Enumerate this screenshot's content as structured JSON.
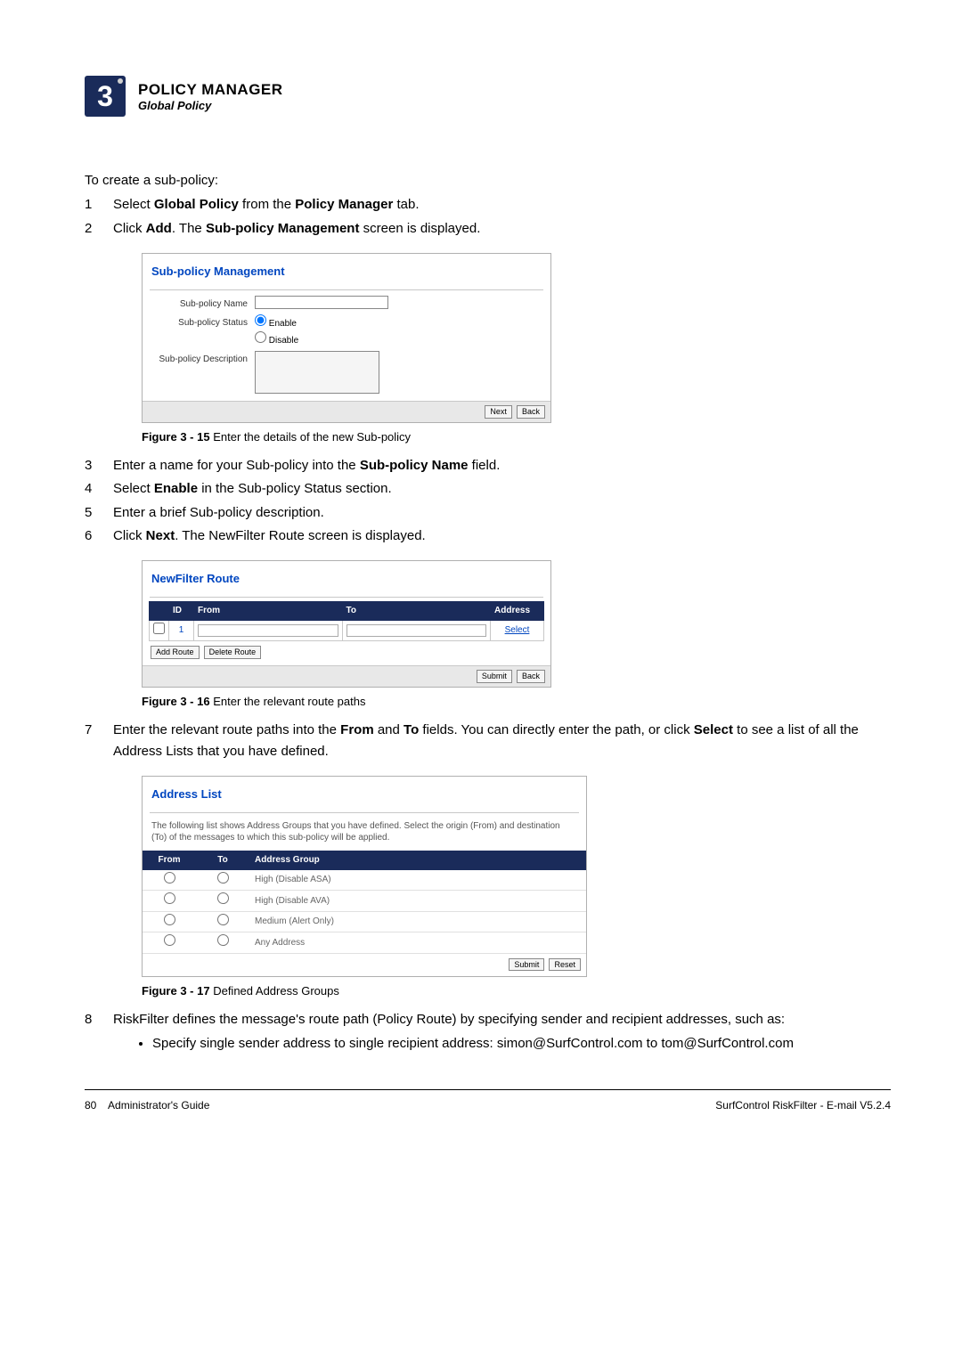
{
  "header": {
    "chapter_num": "3",
    "title": "POLICY MANAGER",
    "subtitle": "Global Policy"
  },
  "intro": "To create a sub-policy:",
  "step1": {
    "pre": "Select ",
    "bold1": "Global Policy",
    "mid": " from the ",
    "bold2": "Policy Manager",
    "post": " tab."
  },
  "step2": {
    "pre": "Click ",
    "bold1": "Add",
    "mid": ". The ",
    "bold2": "Sub-policy Management",
    "post": " screen is displayed."
  },
  "fig1": {
    "title": "Sub-policy Management",
    "label_name": "Sub-policy Name",
    "label_status": "Sub-policy Status",
    "opt_enable": "Enable",
    "opt_disable": "Disable",
    "label_desc": "Sub-policy Description",
    "btn_next": "Next",
    "btn_back": "Back",
    "caption_label": "Figure 3 - 15 ",
    "caption_text": "Enter the details of the new Sub-policy"
  },
  "step3": {
    "pre": "Enter a name for your Sub-policy into the ",
    "bold1": "Sub-policy Name",
    "post": " field."
  },
  "step4": {
    "pre": "Select ",
    "bold1": "Enable",
    "post": " in the Sub-policy Status section."
  },
  "step5": {
    "text": "Enter a brief Sub-policy description."
  },
  "step6": {
    "pre": "Click ",
    "bold1": "Next",
    "post": ". The NewFilter Route screen is displayed."
  },
  "fig2": {
    "title": "NewFilter Route",
    "headers": {
      "id": "ID",
      "from": "From",
      "to": "To",
      "address": "Address"
    },
    "row": {
      "id": "1",
      "select": "Select"
    },
    "btn_add": "Add Route",
    "btn_del": "Delete Route",
    "btn_submit": "Submit",
    "btn_back": "Back",
    "caption_label": "Figure 3 - 16 ",
    "caption_text": "Enter the relevant route paths"
  },
  "step7": {
    "pre": "Enter the relevant route paths into the ",
    "bold1": "From",
    "mid1": " and ",
    "bold2": "To",
    "mid2": " fields. You can directly enter the path, or click ",
    "bold3": "Select",
    "post": " to see a list of all the Address Lists that you have defined."
  },
  "fig3": {
    "title": "Address List",
    "desc": "The following list shows Address Groups that you have defined. Select the origin (From) and destination (To) of the messages to which this sub-policy will be applied.",
    "headers": {
      "from": "From",
      "to": "To",
      "group": "Address Group"
    },
    "rows": [
      {
        "group": "High (Disable ASA)"
      },
      {
        "group": "High (Disable AVA)"
      },
      {
        "group": "Medium (Alert Only)"
      },
      {
        "group": "Any Address"
      }
    ],
    "btn_submit": "Submit",
    "btn_reset": "Reset",
    "caption_label": "Figure 3 - 17 ",
    "caption_text": "Defined Address Groups"
  },
  "step8": {
    "text": "RiskFilter defines the message's route path (Policy Route) by specifying sender and recipient addresses, such as:",
    "bullet1": "Specify single sender address to single recipient address: simon@SurfControl.com to tom@SurfControl.com"
  },
  "footer": {
    "left_page": "80",
    "left_text": "Administrator's Guide",
    "right_text": "SurfControl RiskFilter - E-mail V5.2.4"
  }
}
